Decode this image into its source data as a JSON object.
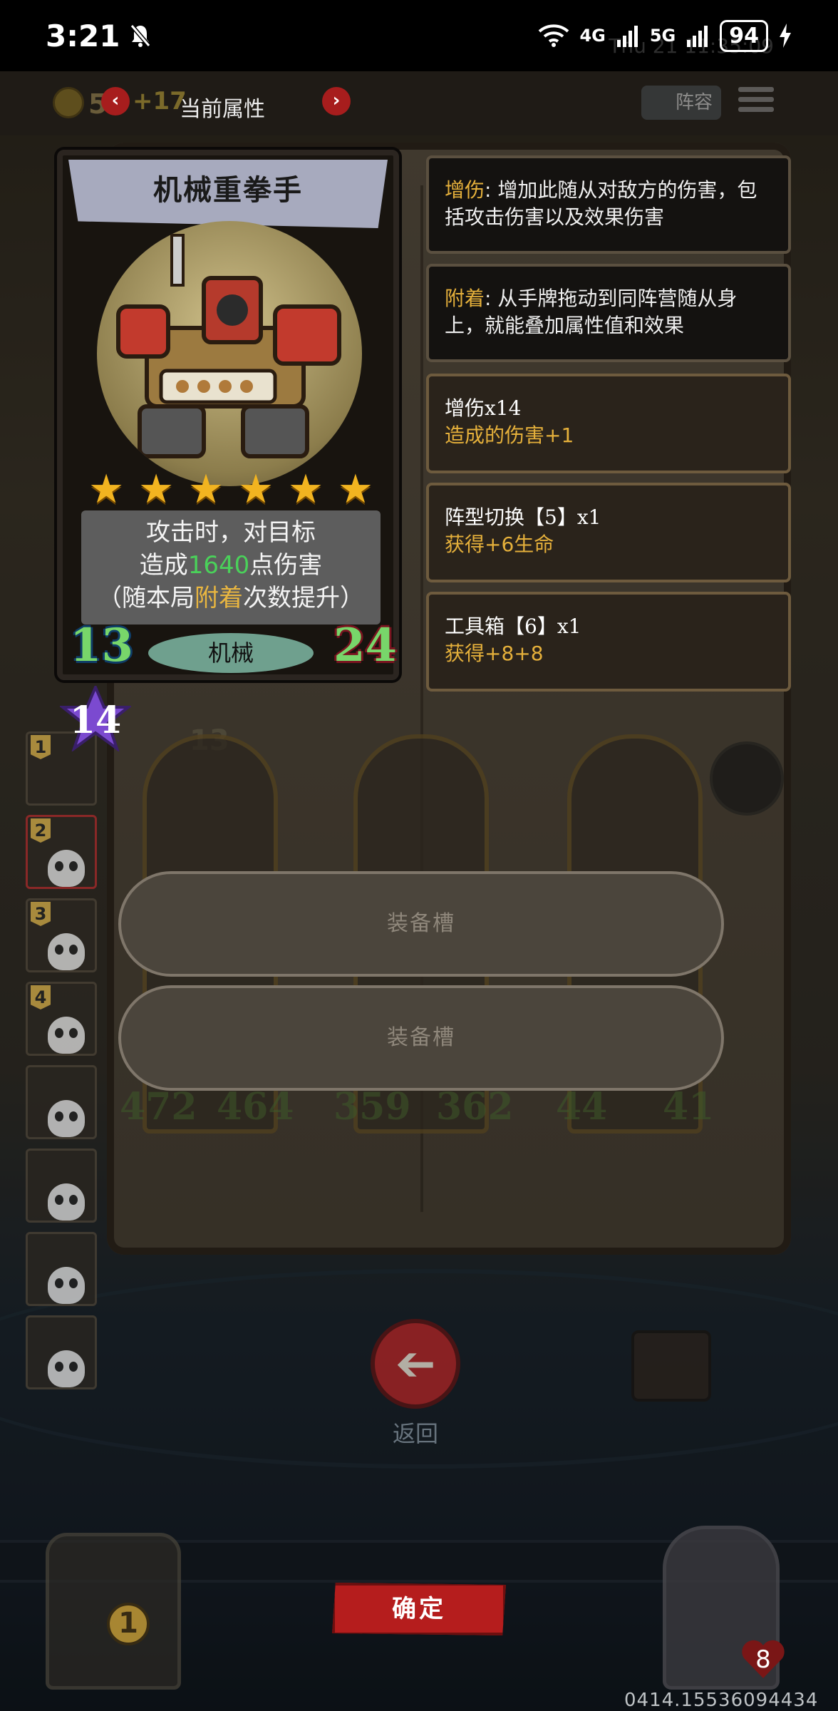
{
  "status_bar": {
    "time": "3:21",
    "network_1": "4G",
    "network_2": "5G",
    "battery": "94"
  },
  "background_overlay_text": "Thu 21 11:35:09",
  "top_bar": {
    "coin_count": "5",
    "coin_delta": "+17",
    "prev": "‹",
    "next": "›",
    "title": "当前属性",
    "lineup_label": "阵容"
  },
  "card": {
    "name": "机械重拳手",
    "stars": 6,
    "description_line1": "攻击时，对目标",
    "description_line2_pre": "造成",
    "description_line2_value": "1640",
    "description_line2_post": "点伤害",
    "description_line3_pre": "（随本局",
    "description_line3_kw": "附着",
    "description_line3_post": "次数提升）",
    "tag": "机械",
    "attack": "13",
    "health": "24",
    "level": "14"
  },
  "info_panels": [
    {
      "keyword": "增伤",
      "text": ": 增加此随从对敌方的伤害，包括攻击伤害以及效果伤害"
    },
    {
      "keyword": "附着",
      "text": ": 从手牌拖动到同阵营随从身上，就能叠加属性值和效果"
    }
  ],
  "buff_panels": [
    {
      "title": "增伤x14",
      "subtitle": "造成的伤害+1"
    },
    {
      "title": "阵型切换【5】x1",
      "subtitle": "获得+6生命"
    },
    {
      "title": "工具箱【6】x1",
      "subtitle": "获得+8+8"
    }
  ],
  "roster": [
    {
      "num": "1"
    },
    {
      "num": "2"
    },
    {
      "num": "3"
    },
    {
      "num": "4"
    },
    {
      "num": ""
    },
    {
      "num": ""
    },
    {
      "num": ""
    },
    {
      "num": ""
    }
  ],
  "background_units": {
    "level_13": "13",
    "stats": [
      "472",
      "464",
      "359",
      "362",
      "44",
      "41"
    ]
  },
  "equip_slots": [
    "装备槽",
    "装备槽"
  ],
  "back": {
    "arrow": "➔",
    "label": "返回"
  },
  "confirm_label": "确定",
  "bottom": {
    "left_badge": "1",
    "right_badge": "8"
  },
  "build_id": "0414.15536094434",
  "colors": {
    "accent_red": "#b51d1d",
    "keyword_gold": "#e5b03b",
    "damage_green": "#4ad15a",
    "star_gold": "#f2b420"
  }
}
